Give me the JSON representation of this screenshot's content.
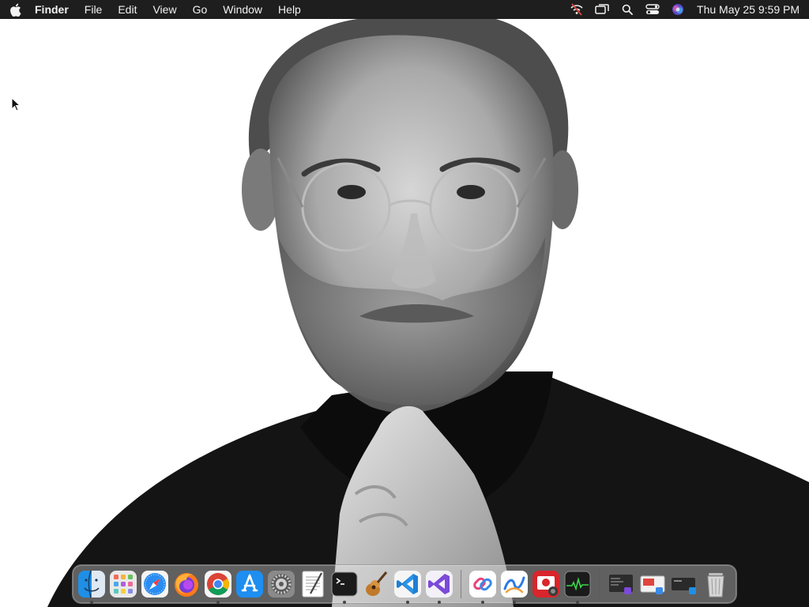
{
  "menubar": {
    "apple_icon": "apple-logo-icon",
    "app_name": "Finder",
    "menus": [
      "File",
      "Edit",
      "View",
      "Go",
      "Window",
      "Help"
    ],
    "status_icons": [
      "no-wifi-icon",
      "screen-mirroring-icon",
      "search-icon",
      "control-center-icon",
      "siri-icon"
    ],
    "clock": "Thu May 25  9:59 PM"
  },
  "wallpaper": {
    "description_icon": "portrait-wallpaper"
  },
  "dock": {
    "apps": [
      {
        "name": "Finder",
        "icon": "finder-icon",
        "running": true
      },
      {
        "name": "Launchpad",
        "icon": "launchpad-icon",
        "running": false
      },
      {
        "name": "Safari",
        "icon": "safari-icon",
        "running": false
      },
      {
        "name": "Firefox",
        "icon": "firefox-icon",
        "running": false
      },
      {
        "name": "Google Chrome",
        "icon": "chrome-icon",
        "running": true
      },
      {
        "name": "App Store",
        "icon": "app-store-icon",
        "running": false
      },
      {
        "name": "System Preferences",
        "icon": "settings-icon",
        "running": false
      },
      {
        "name": "TextEdit",
        "icon": "textedit-icon",
        "running": false
      },
      {
        "name": "Terminal",
        "icon": "terminal-icon",
        "running": true
      },
      {
        "name": "Instruments",
        "icon": "instruments-icon",
        "running": false
      },
      {
        "name": "Visual Studio Code",
        "icon": "vscode-icon",
        "running": true
      },
      {
        "name": "Visual Studio",
        "icon": "visual-studio-icon",
        "running": true
      }
    ],
    "apps2": [
      {
        "name": "Link App",
        "icon": "link-app-icon",
        "running": true
      },
      {
        "name": "Freeform",
        "icon": "freeform-icon",
        "running": true
      },
      {
        "name": "Photo Booth",
        "icon": "photobooth-icon",
        "running": false
      },
      {
        "name": "Activity Monitor",
        "icon": "activity-monitor-icon",
        "running": true
      }
    ],
    "recents": [
      {
        "name": "Recent Window 1",
        "icon": "recent-window-icon"
      },
      {
        "name": "Recent Window 2",
        "icon": "recent-window-icon"
      },
      {
        "name": "Recent Window 3",
        "icon": "recent-window-icon"
      }
    ],
    "trash": {
      "name": "Trash",
      "icon": "trash-icon"
    }
  }
}
